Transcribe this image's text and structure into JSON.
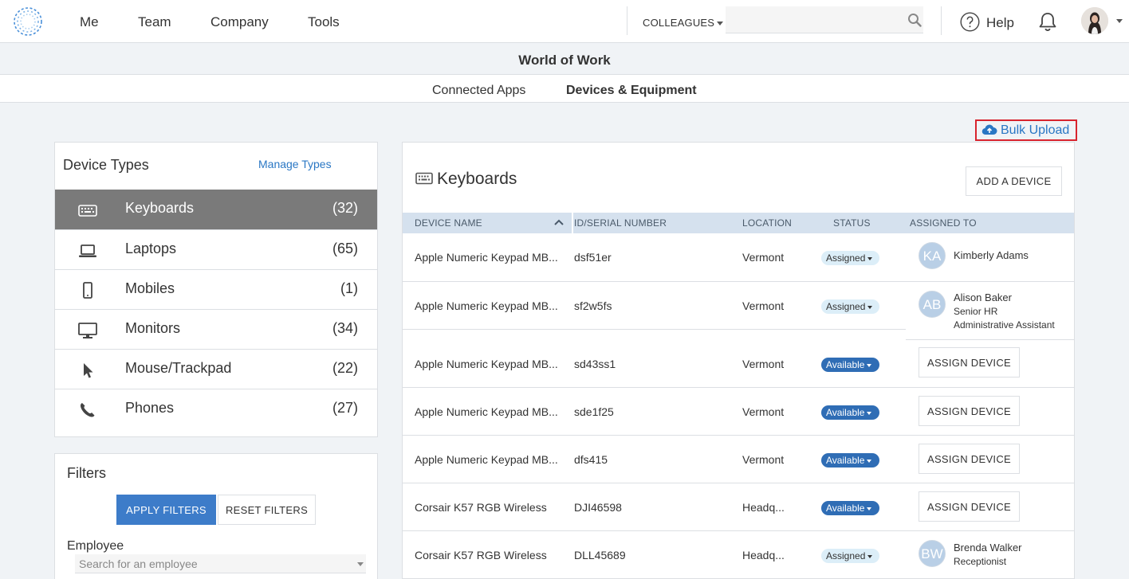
{
  "nav": {
    "links": [
      "Me",
      "Team",
      "Company",
      "Tools"
    ],
    "colleagues": "COLLEAGUES",
    "search_placeholder": "",
    "help": "Help"
  },
  "page_title": "World of Work",
  "subtabs": [
    "Connected Apps",
    "Devices & Equipment"
  ],
  "bulk_upload": "Bulk Upload",
  "device_types": {
    "title": "Device Types",
    "manage": "Manage Types",
    "items": [
      {
        "label": "Keyboards",
        "count": "(32)",
        "icon": "keyboard-icon"
      },
      {
        "label": "Laptops",
        "count": "(65)",
        "icon": "laptop-icon"
      },
      {
        "label": "Mobiles",
        "count": "(1)",
        "icon": "mobile-icon"
      },
      {
        "label": "Monitors",
        "count": "(34)",
        "icon": "monitor-icon"
      },
      {
        "label": "Mouse/Trackpad",
        "count": "(22)",
        "icon": "cursor-icon"
      },
      {
        "label": "Phones",
        "count": "(27)",
        "icon": "phone-icon"
      }
    ]
  },
  "filters": {
    "title": "Filters",
    "apply": "APPLY FILTERS",
    "reset": "RESET FILTERS",
    "employee_label": "Employee",
    "employee_placeholder": "Search for an employee"
  },
  "devices": {
    "title": "Keyboards",
    "add": "ADD A DEVICE",
    "columns": [
      "DEVICE NAME",
      "ID/SERIAL NUMBER",
      "LOCATION",
      "STATUS",
      "ASSIGNED TO"
    ],
    "assign_label": "ASSIGN DEVICE",
    "rows": [
      {
        "name": "Apple Numeric Keypad MB...",
        "serial": "dsf51er",
        "location": "Vermont",
        "status": "Assigned",
        "initials": "KA",
        "assignee": "Kimberly Adams",
        "role": ""
      },
      {
        "name": "Apple Numeric Keypad MB...",
        "serial": "sf2w5fs",
        "location": "Vermont",
        "status": "Assigned",
        "initials": "AB",
        "assignee": "Alison Baker",
        "role": "Senior HR",
        "role2": "Administrative Assistant"
      },
      {
        "name": "Apple Numeric Keypad MB...",
        "serial": "sd43ss1",
        "location": "Vermont",
        "status": "Available"
      },
      {
        "name": "Apple Numeric Keypad MB...",
        "serial": "sde1f25",
        "location": "Vermont",
        "status": "Available"
      },
      {
        "name": "Apple Numeric Keypad MB...",
        "serial": "dfs415",
        "location": "Vermont",
        "status": "Available"
      },
      {
        "name": "Corsair K57 RGB Wireless",
        "serial": "DJI46598",
        "location": "Headq...",
        "status": "Available"
      },
      {
        "name": "Corsair K57 RGB Wireless",
        "serial": "DLL45689",
        "location": "Headq...",
        "status": "Assigned",
        "initials": "BW",
        "assignee": "Brenda Walker",
        "role": "Receptionist"
      }
    ]
  }
}
